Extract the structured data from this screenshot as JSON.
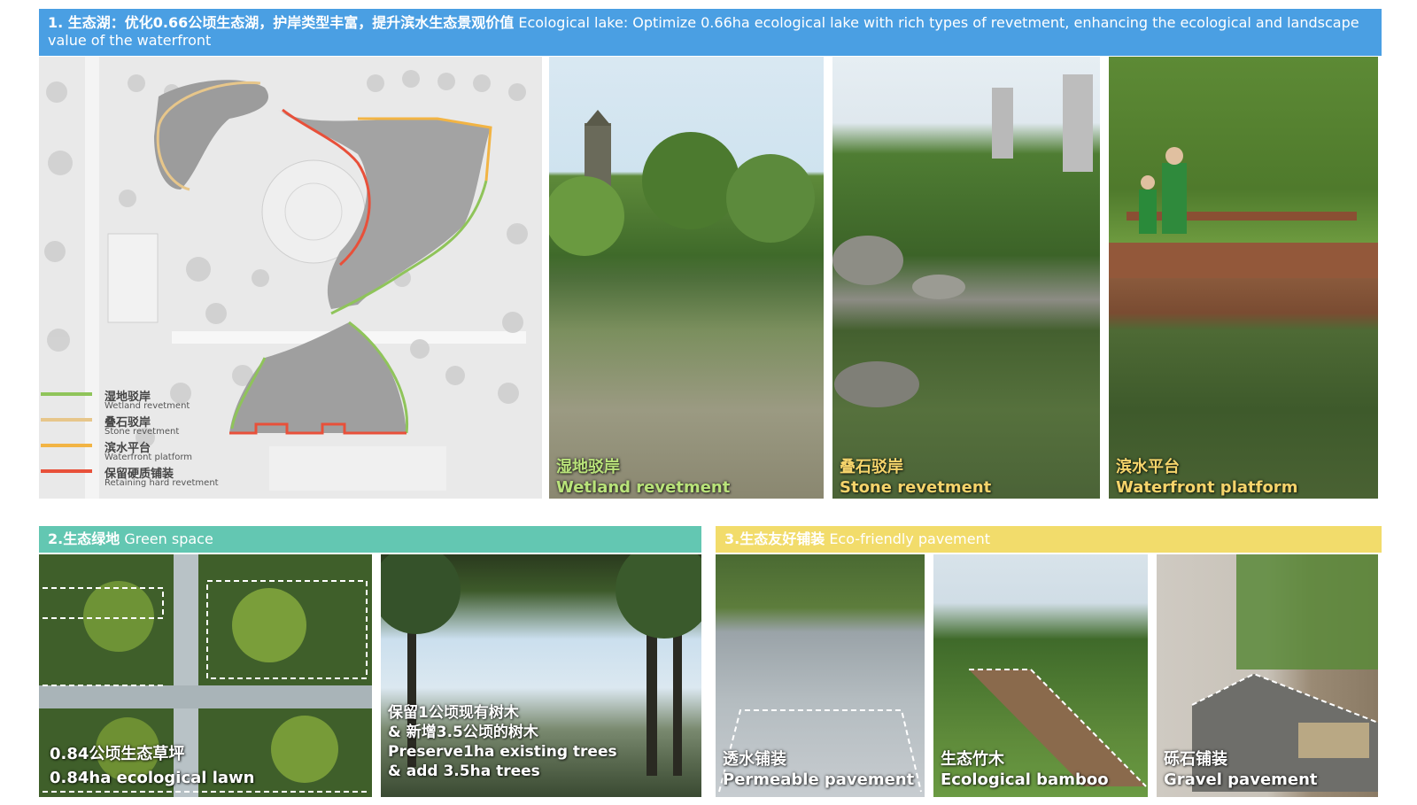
{
  "section1": {
    "title_zh": "1. 生态湖：优化0.66公顷生态湖，护岸类型丰富，提升滨水生态景观价值",
    "title_en": "Ecological lake: Optimize 0.66ha ecological lake with rich types of revetment, enhancing the ecological and landscape value of the waterfront",
    "legend": [
      {
        "zh": "湿地驳岸",
        "en": "Wetland revetment",
        "color": "#8fc45a"
      },
      {
        "zh": "叠石驳岸",
        "en": "Stone revetment",
        "color": "#e7c68a"
      },
      {
        "zh": "滨水平台",
        "en": "Waterfront platform",
        "color": "#f2b444"
      },
      {
        "zh": "保留硬质铺装",
        "en": "Retaining hard revetment",
        "color": "#e8503a"
      }
    ],
    "photos": [
      {
        "zh": "湿地驳岸",
        "en": "Wetland revetment"
      },
      {
        "zh": "叠石驳岸",
        "en": "Stone revetment"
      },
      {
        "zh": "滨水平台",
        "en": "Waterfront platform"
      }
    ]
  },
  "section2": {
    "title_zh": "2.生态绿地",
    "title_en": "Green space",
    "photos": [
      {
        "line1": "0.84公顷生态草坪",
        "line2": "0.84ha ecological lawn"
      },
      {
        "line1": "保留1公顷现有树木",
        "line2": "& 新增3.5公顷的树木",
        "line3": "Preserve1ha existing trees",
        "line4": "& add 3.5ha trees"
      }
    ]
  },
  "section3": {
    "title_zh": "3.生态友好铺装",
    "title_en": "Eco-friendly pavement",
    "photos": [
      {
        "zh": "透水铺装",
        "en": "Permeable pavement"
      },
      {
        "zh": "生态竹木",
        "en": "Ecological bamboo"
      },
      {
        "zh": "砾石铺装",
        "en": "Gravel pavement"
      }
    ]
  },
  "colors": {
    "banner1": "#4a9fe3",
    "banner2": "#63c7b2",
    "banner3": "#f2dc6b"
  }
}
